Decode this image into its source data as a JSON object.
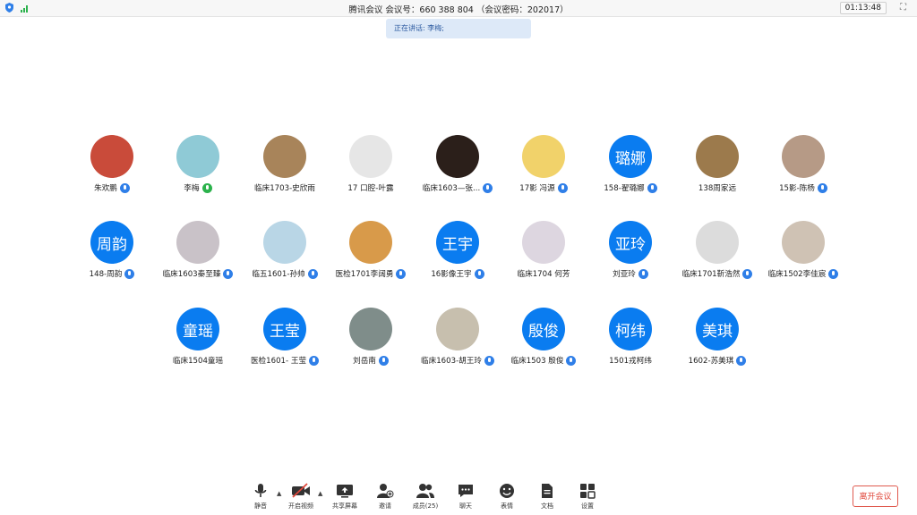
{
  "titlebar": {
    "title": "腾讯会议  会议号：660 388 804  （会议密码：202017）",
    "timer": "01:13:48",
    "fullscreen_symbol": "⛶"
  },
  "speaking": {
    "text": "正在讲话: 李梅;"
  },
  "participants": [
    {
      "name": "朱欢鹏",
      "avatar": "",
      "avatar_color": "#c94b3a"
    },
    {
      "name": "李梅",
      "avatar": "",
      "avatar_color": "#8fcad6"
    },
    {
      "name": "临床1703-史欣雨",
      "avatar": "",
      "avatar_color": "#a8845a"
    },
    {
      "name": "17 口腔-叶露",
      "avatar": "",
      "avatar_color": "#e6e6e6"
    },
    {
      "name": "临床1603—张...",
      "avatar": "",
      "avatar_color": "#2b1f1a"
    },
    {
      "name": "17影 冯源",
      "avatar": "",
      "avatar_color": "#f1d26a"
    },
    {
      "name": "158-翟璐娜",
      "avatar": "璐娜",
      "avatar_color": "#0a7cf0"
    },
    {
      "name": "138周家远",
      "avatar": "",
      "avatar_color": "#9c7a4c"
    },
    {
      "name": "15影-陈杨",
      "avatar": "",
      "avatar_color": "#b69a86"
    },
    {
      "name": "148-周韵",
      "avatar": "周韵",
      "avatar_color": "#0a7cf0"
    },
    {
      "name": "临床1603秦至臻",
      "avatar": "",
      "avatar_color": "#c9c2c8"
    },
    {
      "name": "临五1601-孙帅",
      "avatar": "",
      "avatar_color": "#b9d6e6"
    },
    {
      "name": "医检1701李阔勇",
      "avatar": "",
      "avatar_color": "#d89a4a"
    },
    {
      "name": "16影像王宇",
      "avatar": "王宇",
      "avatar_color": "#0a7cf0"
    },
    {
      "name": "临床1704 何芳",
      "avatar": "",
      "avatar_color": "#ddd6e0"
    },
    {
      "name": "刘亚玲",
      "avatar": "亚玲",
      "avatar_color": "#0a7cf0"
    },
    {
      "name": "临床1701靳浩然",
      "avatar": "",
      "avatar_color": "#dcdcdc"
    },
    {
      "name": "临床1502李佳宸",
      "avatar": "",
      "avatar_color": "#cfc2b4"
    },
    {
      "name": "临床1504童瑶",
      "avatar": "童瑶",
      "avatar_color": "#0a7cf0"
    },
    {
      "name": "医检1601- 王莹",
      "avatar": "王莹",
      "avatar_color": "#0a7cf0"
    },
    {
      "name": "刘岳南",
      "avatar": "",
      "avatar_color": "#7f8d8a"
    },
    {
      "name": "临床1603-胡王玲",
      "avatar": "",
      "avatar_color": "#c7bfae"
    },
    {
      "name": "临床1503 殷俊",
      "avatar": "殷俊",
      "avatar_color": "#0a7cf0"
    },
    {
      "name": "1501戎柯纬",
      "avatar": "柯纬",
      "avatar_color": "#0a7cf0"
    },
    {
      "name": "1602-苏美琪",
      "avatar": "美琪",
      "avatar_color": "#0a7cf0"
    }
  ],
  "toolbar": {
    "mute": "静音",
    "video": "开启视频",
    "share": "共享屏幕",
    "invite": "邀请",
    "members": "成员(25)",
    "chat": "聊天",
    "emoji": "表情",
    "docs": "文档",
    "settings": "设置",
    "leave": "离开会议",
    "caret": "▲"
  }
}
